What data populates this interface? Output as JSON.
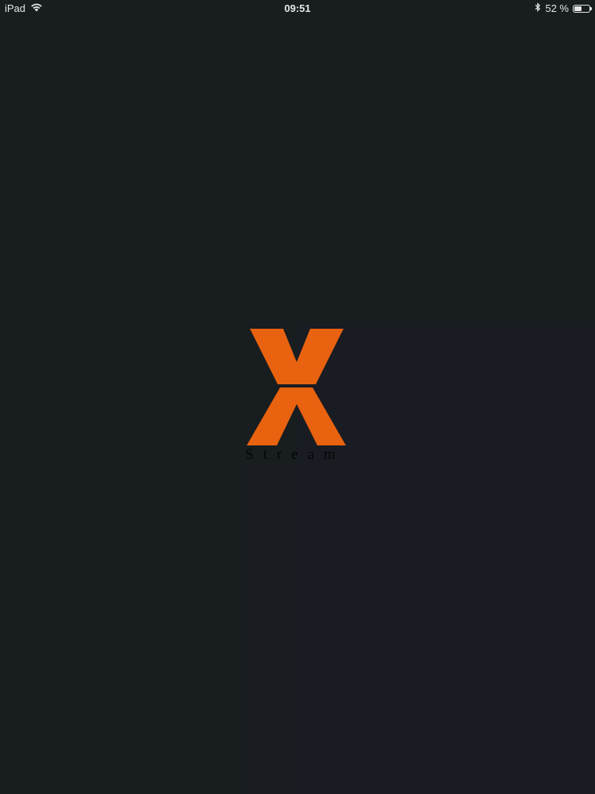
{
  "status_bar": {
    "device": "iPad",
    "time": "09:51",
    "battery_percent_text": "52 %",
    "battery_level": 0.52,
    "icons": [
      "wifi-icon",
      "bluetooth-icon",
      "battery-icon"
    ]
  },
  "splash": {
    "logo_letter": "X",
    "logo_wordmark": "Stream",
    "logo_color": "#e8620f",
    "background_color": "#181d1f"
  }
}
